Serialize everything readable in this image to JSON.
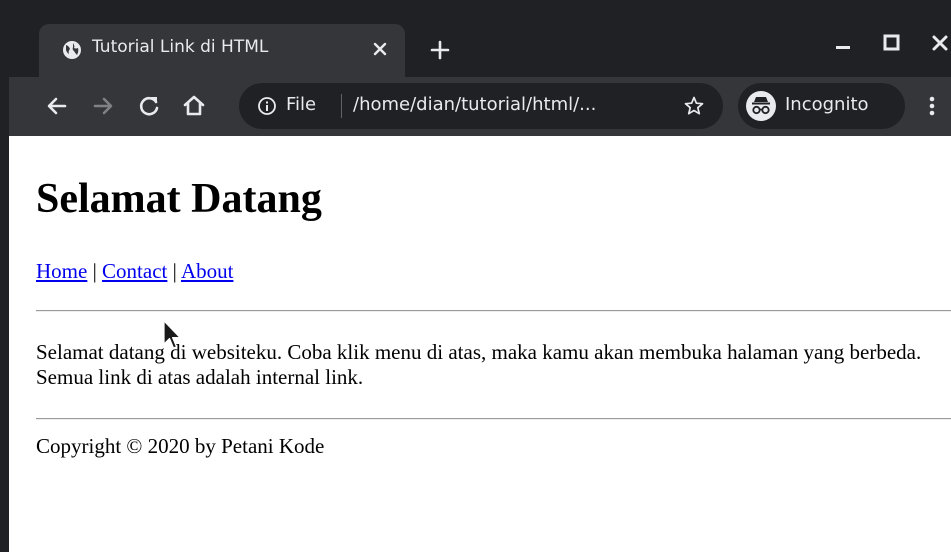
{
  "browser": {
    "tab": {
      "title": "Tutorial Link di HTML",
      "favicon": "globe-icon",
      "close_icon": "close-icon"
    },
    "new_tab_icon": "plus-icon",
    "window_controls": [
      "minimize-icon",
      "maximize-icon",
      "close-icon"
    ],
    "toolbar": {
      "back_icon": "arrow-left-icon",
      "forward_icon": "arrow-right-icon",
      "reload_icon": "reload-icon",
      "home_icon": "home-icon",
      "omnibox": {
        "info_icon": "info-icon",
        "scheme_label": "File",
        "url": "/home/dian/tutorial/html/...",
        "bookmark_icon": "star-icon"
      },
      "incognito_label": "Incognito",
      "menu_icon": "more-vert-icon"
    },
    "colors": {
      "frame": "#202124",
      "toolbar": "#35363a",
      "text": "#e8eaed",
      "link": "#0000ee"
    }
  },
  "page": {
    "heading": "Selamat Datang",
    "nav": {
      "links": [
        "Home",
        "Contact",
        "About"
      ],
      "separator": "|"
    },
    "paragraph": "Selamat datang di websiteku. Coba klik menu di atas, maka kamu akan membuka halaman yang berbeda. Semua link di atas adalah internal link.",
    "footer": "Copyright © 2020 by Petani Kode"
  }
}
